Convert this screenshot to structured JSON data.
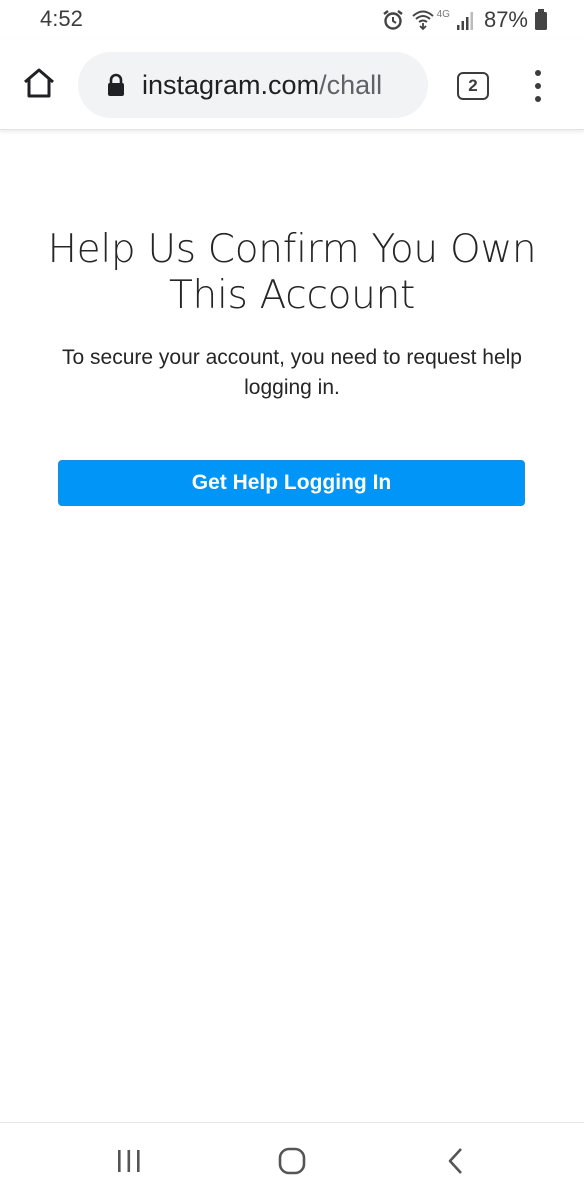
{
  "status_bar": {
    "time": "4:52",
    "network": "4G",
    "battery": "87%",
    "icons": [
      "alarm-icon",
      "wifi-calling-icon",
      "signal-icon",
      "battery-icon"
    ]
  },
  "browser": {
    "url_host": "instagram.com",
    "url_path": "/chall",
    "tab_count": "2",
    "icons": [
      "home-icon",
      "lock-icon",
      "more-vert-icon"
    ]
  },
  "page": {
    "title": "Help Us Confirm You Own This Account",
    "description": "To secure your account, you need to request help logging in.",
    "button_label": "Get Help Logging In"
  },
  "nav": {
    "icons": [
      "recent-apps-icon",
      "home-circle-icon",
      "back-icon"
    ]
  },
  "colors": {
    "accent": "#0095f6",
    "text": "#262626",
    "url_bar_bg": "#f1f3f4"
  }
}
